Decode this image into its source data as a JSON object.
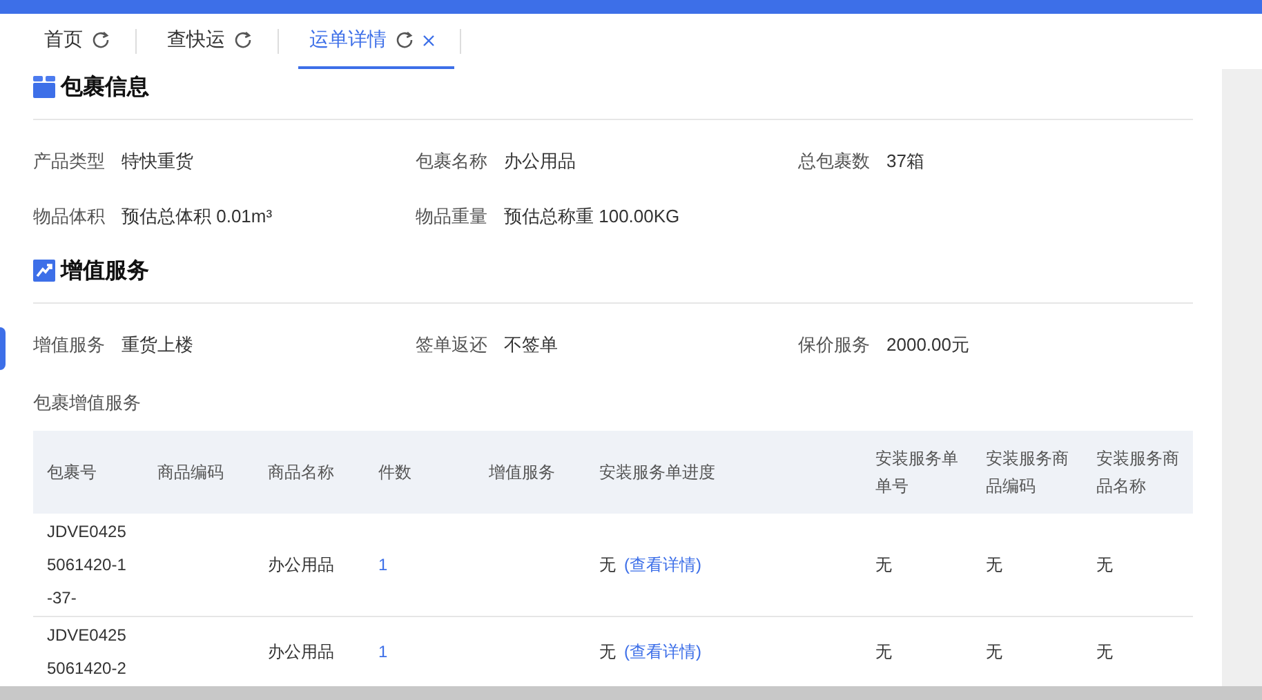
{
  "tabs": [
    {
      "label": "首页",
      "selected": false,
      "closable": false
    },
    {
      "label": "查快运",
      "selected": false,
      "closable": false
    },
    {
      "label": "运单详情",
      "selected": true,
      "closable": true
    }
  ],
  "sections": [
    {
      "title": "包裹信息",
      "kind": "package",
      "fields": [
        {
          "label": "产品类型",
          "value": "特快重货"
        },
        {
          "label": "包裹名称",
          "value": "办公用品"
        },
        {
          "label": "总包裹数",
          "value": "37箱"
        },
        {
          "label": "物品体积",
          "value": "预估总体积 0.01m³"
        },
        {
          "label": "物品重量",
          "value": "预估总称重 100.00KG"
        }
      ]
    },
    {
      "title": "增值服务",
      "kind": "trend",
      "fields": [
        {
          "label": "增值服务",
          "value": "重货上楼"
        },
        {
          "label": "签单返还",
          "value": "不签单"
        },
        {
          "label": "保价服务",
          "value": "2000.00元"
        }
      ]
    }
  ],
  "table": {
    "title": "包裹增值服务",
    "columns": [
      "包裹号",
      "商品编码",
      "商品名称",
      "件数",
      "增值服务",
      "安装服务单进度",
      "安装服务单单号",
      "安装服务商品编码",
      "安装服务商品名称"
    ],
    "rows": [
      {
        "cells": [
          "JDVE04255061420-1-37-",
          "",
          "办公用品",
          "1",
          "",
          "无",
          "无",
          "无",
          "无"
        ],
        "link": "(查看详情)"
      },
      {
        "cells": [
          "JDVE04255061420-2",
          "",
          "办公用品",
          "1",
          "",
          "无",
          "无",
          "无",
          "无"
        ],
        "link": "(查看详情)"
      }
    ]
  }
}
